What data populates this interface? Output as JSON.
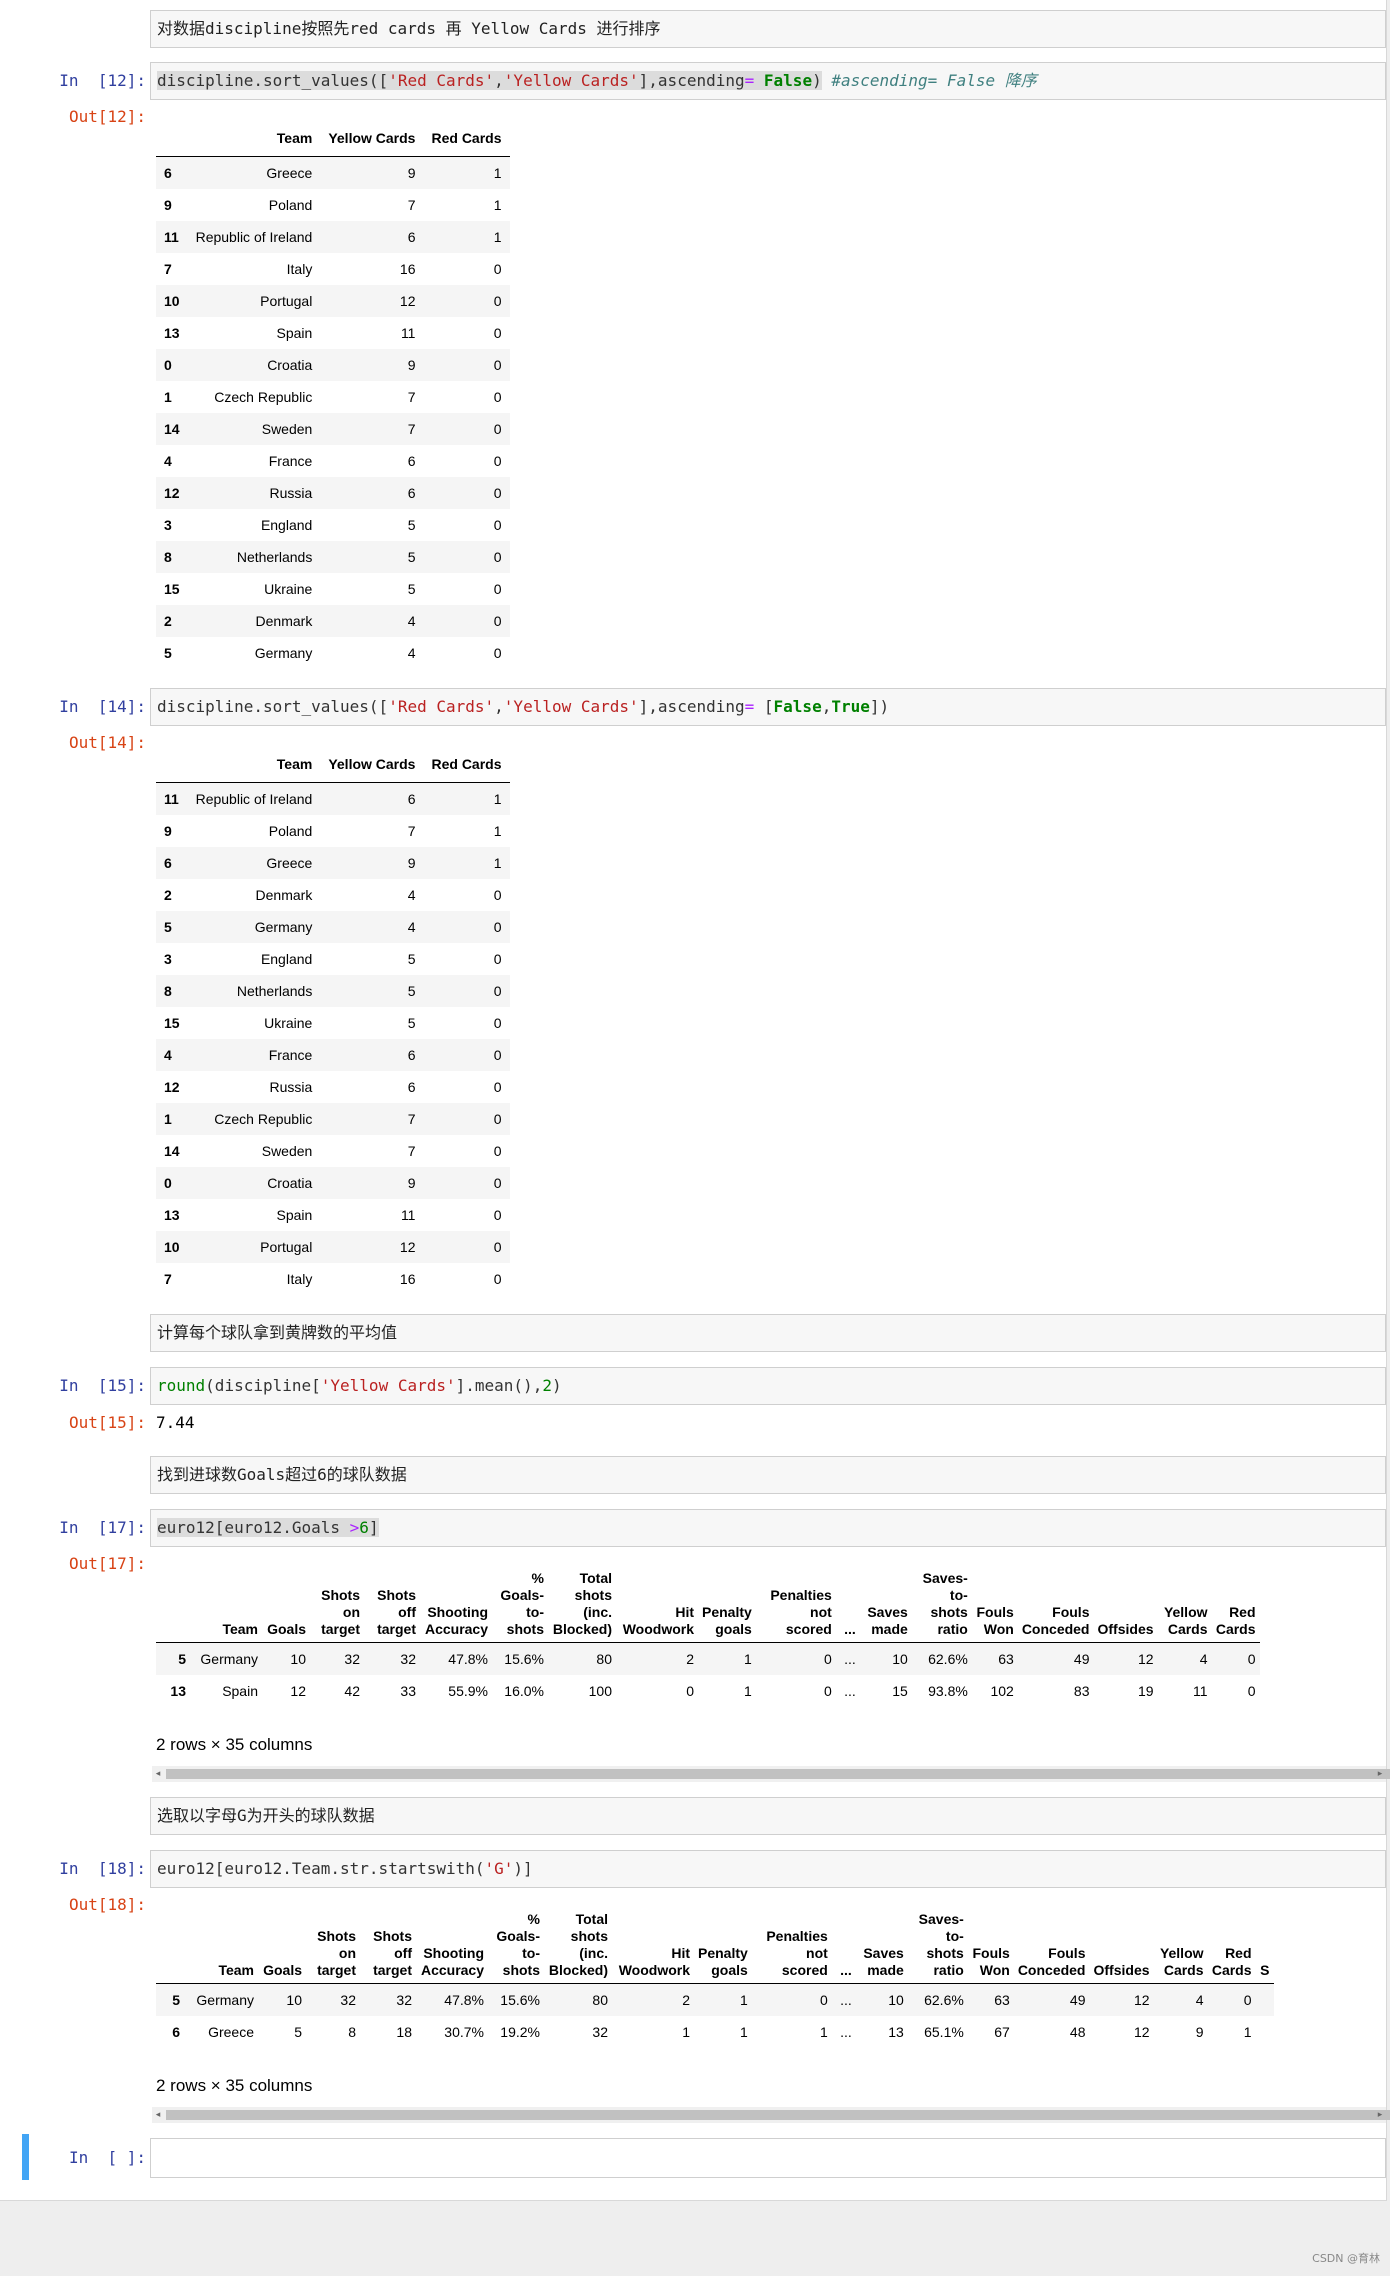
{
  "cells": {
    "md1": "对数据discipline按照先red cards 再 Yellow Cards 进行排序",
    "in12_prompt": "In  [12]:",
    "out12_prompt": "Out[12]:",
    "in14_prompt": "In  [14]:",
    "out14_prompt": "Out[14]:",
    "md2": "计算每个球队拿到黄牌数的平均值",
    "in15_prompt": "In  [15]:",
    "out15_prompt": "Out[15]:",
    "out15_value": "7.44",
    "md3": "找到进球数Goals超过6的球队数据",
    "in17_prompt": "In  [17]:",
    "out17_prompt": "Out[17]:",
    "md4": "选取以字母G为开头的球队数据",
    "in18_prompt": "In  [18]:",
    "out18_prompt": "Out[18]:",
    "in_empty_prompt": "In  [ ]:"
  },
  "code": {
    "c12": {
      "a": "discipline.sort_values([",
      "s1": "'Red Cards'",
      "comma": ",",
      "s2": "'Yellow Cards'",
      "b": "],ascending",
      "eq": "=",
      "sp": " ",
      "kw": "False",
      "c": ")",
      "comment": " #ascending= False 降序"
    },
    "c14": {
      "a": "discipline.sort_values([",
      "s1": "'Red Cards'",
      "comma": ",",
      "s2": "'Yellow Cards'",
      "b": "],ascending",
      "eq": "=",
      "sp": " [",
      "kw1": "False",
      "mid": ",",
      "kw2": "True",
      "c": "])"
    },
    "c15": {
      "fn": "round",
      "a": "(discipline[",
      "s": "'Yellow Cards'",
      "b": "].mean(),",
      "n": "2",
      "c": ")"
    },
    "c17": {
      "a": "euro12[euro12.Goals ",
      "op": ">",
      "n": "6",
      "c": "]"
    },
    "c18": {
      "a": "euro12[euro12.Team.str.startswith(",
      "s": "'G'",
      "c": ")]"
    }
  },
  "table12": {
    "headers": [
      "",
      "Team",
      "Yellow Cards",
      "Red Cards"
    ],
    "rows": [
      [
        "6",
        "Greece",
        "9",
        "1"
      ],
      [
        "9",
        "Poland",
        "7",
        "1"
      ],
      [
        "11",
        "Republic of Ireland",
        "6",
        "1"
      ],
      [
        "7",
        "Italy",
        "16",
        "0"
      ],
      [
        "10",
        "Portugal",
        "12",
        "0"
      ],
      [
        "13",
        "Spain",
        "11",
        "0"
      ],
      [
        "0",
        "Croatia",
        "9",
        "0"
      ],
      [
        "1",
        "Czech Republic",
        "7",
        "0"
      ],
      [
        "14",
        "Sweden",
        "7",
        "0"
      ],
      [
        "4",
        "France",
        "6",
        "0"
      ],
      [
        "12",
        "Russia",
        "6",
        "0"
      ],
      [
        "3",
        "England",
        "5",
        "0"
      ],
      [
        "8",
        "Netherlands",
        "5",
        "0"
      ],
      [
        "15",
        "Ukraine",
        "5",
        "0"
      ],
      [
        "2",
        "Denmark",
        "4",
        "0"
      ],
      [
        "5",
        "Germany",
        "4",
        "0"
      ]
    ]
  },
  "table14": {
    "headers": [
      "",
      "Team",
      "Yellow Cards",
      "Red Cards"
    ],
    "rows": [
      [
        "11",
        "Republic of Ireland",
        "6",
        "1"
      ],
      [
        "9",
        "Poland",
        "7",
        "1"
      ],
      [
        "6",
        "Greece",
        "9",
        "1"
      ],
      [
        "2",
        "Denmark",
        "4",
        "0"
      ],
      [
        "5",
        "Germany",
        "4",
        "0"
      ],
      [
        "3",
        "England",
        "5",
        "0"
      ],
      [
        "8",
        "Netherlands",
        "5",
        "0"
      ],
      [
        "15",
        "Ukraine",
        "5",
        "0"
      ],
      [
        "4",
        "France",
        "6",
        "0"
      ],
      [
        "12",
        "Russia",
        "6",
        "0"
      ],
      [
        "1",
        "Czech Republic",
        "7",
        "0"
      ],
      [
        "14",
        "Sweden",
        "7",
        "0"
      ],
      [
        "0",
        "Croatia",
        "9",
        "0"
      ],
      [
        "13",
        "Spain",
        "11",
        "0"
      ],
      [
        "10",
        "Portugal",
        "12",
        "0"
      ],
      [
        "7",
        "Italy",
        "16",
        "0"
      ]
    ]
  },
  "table17": {
    "headers": [
      "",
      "Team",
      "Goals",
      "Shots on target",
      "Shots off target",
      "Shooting Accuracy",
      "% Goals-to-shots",
      "Total shots (inc. Blocked)",
      "Hit Woodwork",
      "Penalty goals",
      "Penalties not scored",
      "...",
      "Saves made",
      "Saves-to-shots ratio",
      "Fouls Won",
      "Fouls Conceded",
      "Offsides",
      "Yellow Cards",
      "Red Cards"
    ],
    "header_lines": [
      [
        ""
      ],
      [
        "Team"
      ],
      [
        "Goals"
      ],
      [
        "Shots",
        "on",
        "target"
      ],
      [
        "Shots",
        "off",
        "target"
      ],
      [
        "Shooting",
        "Accuracy"
      ],
      [
        "%",
        "Goals-",
        "to-",
        "shots"
      ],
      [
        "Total",
        "shots",
        "(inc.",
        "Blocked)"
      ],
      [
        "Hit",
        "Woodwork"
      ],
      [
        "Penalty",
        "goals"
      ],
      [
        "Penalties",
        "not",
        "scored"
      ],
      [
        "..."
      ],
      [
        "Saves",
        "made"
      ],
      [
        "Saves-",
        "to-",
        "shots",
        "ratio"
      ],
      [
        "Fouls",
        "Won"
      ],
      [
        "Fouls",
        "Conceded"
      ],
      [
        "Offsides"
      ],
      [
        "Yellow",
        "Cards"
      ],
      [
        "Red",
        "Cards"
      ]
    ],
    "rows": [
      [
        "5",
        "Germany",
        "10",
        "32",
        "32",
        "47.8%",
        "15.6%",
        "80",
        "2",
        "1",
        "0",
        "...",
        "10",
        "62.6%",
        "63",
        "49",
        "12",
        "4",
        "0"
      ],
      [
        "13",
        "Spain",
        "12",
        "42",
        "33",
        "55.9%",
        "16.0%",
        "100",
        "0",
        "1",
        "0",
        "...",
        "15",
        "93.8%",
        "102",
        "83",
        "19",
        "11",
        "0"
      ]
    ],
    "footer": "2 rows × 35 columns"
  },
  "table18": {
    "header_lines": [
      [
        ""
      ],
      [
        "Team"
      ],
      [
        "Goals"
      ],
      [
        "Shots",
        "on",
        "target"
      ],
      [
        "Shots",
        "off",
        "target"
      ],
      [
        "Shooting",
        "Accuracy"
      ],
      [
        "%",
        "Goals-",
        "to-",
        "shots"
      ],
      [
        "Total",
        "shots",
        "(inc.",
        "Blocked)"
      ],
      [
        "Hit",
        "Woodwork"
      ],
      [
        "Penalty",
        "goals"
      ],
      [
        "Penalties",
        "not",
        "scored"
      ],
      [
        "..."
      ],
      [
        "Saves",
        "made"
      ],
      [
        "Saves-",
        "to-",
        "shots",
        "ratio"
      ],
      [
        "Fouls",
        "Won"
      ],
      [
        "Fouls",
        "Conceded"
      ],
      [
        "Offsides"
      ],
      [
        "Yellow",
        "Cards"
      ],
      [
        "Red",
        "Cards"
      ],
      [
        "S"
      ]
    ],
    "rows": [
      [
        "5",
        "Germany",
        "10",
        "32",
        "32",
        "47.8%",
        "15.6%",
        "80",
        "2",
        "1",
        "0",
        "...",
        "10",
        "62.6%",
        "63",
        "49",
        "12",
        "4",
        "0",
        ""
      ],
      [
        "6",
        "Greece",
        "5",
        "8",
        "18",
        "30.7%",
        "19.2%",
        "32",
        "1",
        "1",
        "1",
        "...",
        "13",
        "65.1%",
        "67",
        "48",
        "12",
        "9",
        "1",
        ""
      ]
    ],
    "footer": "2 rows × 35 columns"
  },
  "scroll": {
    "left_arrow": "◂",
    "right_arrow": "▸"
  },
  "watermark": "CSDN @育林"
}
